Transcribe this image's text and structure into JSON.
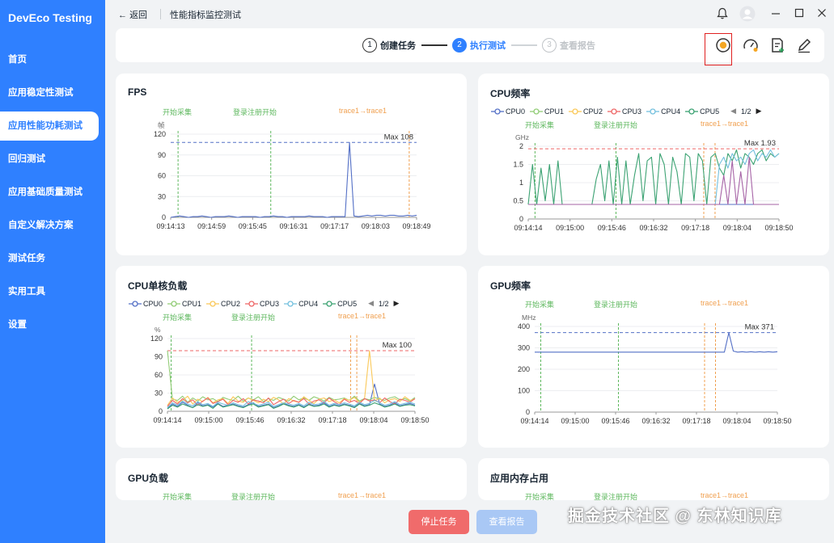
{
  "app": {
    "name": "DevEco Testing"
  },
  "sidebar": {
    "items": [
      {
        "label": "首页"
      },
      {
        "label": "应用稳定性测试"
      },
      {
        "label": "应用性能功耗测试",
        "active": true
      },
      {
        "label": "回归测试"
      },
      {
        "label": "应用基础质量测试"
      },
      {
        "label": "自定义解决方案"
      },
      {
        "label": "测试任务"
      },
      {
        "label": "实用工具"
      },
      {
        "label": "设置"
      }
    ]
  },
  "titlebar": {
    "back_label": "返回",
    "title": "性能指标监控测试",
    "icons": [
      "bell-icon",
      "avatar-icon",
      "minimize-icon",
      "maximize-icon",
      "close-icon"
    ]
  },
  "stepper": {
    "steps": [
      {
        "num": "1",
        "label": "创建任务",
        "state": "done"
      },
      {
        "num": "2",
        "label": "执行测试",
        "state": "active"
      },
      {
        "num": "3",
        "label": "查看报告",
        "state": "disabled"
      }
    ],
    "tools": [
      "record-icon",
      "gauge-icon",
      "add-document-icon",
      "edit-icon"
    ]
  },
  "colors": {
    "accent": "#2f80ff",
    "series": [
      "#5470c6",
      "#91cc75",
      "#fac858",
      "#ee6666",
      "#73c0de",
      "#3ba272"
    ],
    "marker_green": "#5fb85f",
    "marker_orange": "#f0a050",
    "stop_button": "#f06b6b",
    "report_button": "#a9c8f5"
  },
  "markers": {
    "start": "开始采集",
    "login": "登录注册开始",
    "trace": "trace1→trace1"
  },
  "legend": {
    "items": [
      "CPU0",
      "CPU1",
      "CPU2",
      "CPU3",
      "CPU4",
      "CPU5"
    ],
    "page": "1/2"
  },
  "charts": {
    "fps": {
      "title": "FPS",
      "unit": "帧",
      "max_label": "Max 108"
    },
    "cpu_freq": {
      "title": "CPU频率",
      "unit": "GHz",
      "max_label": "Max 1.93"
    },
    "cpu_load": {
      "title": "CPU单核负载",
      "unit": "%",
      "max_label": "Max 100"
    },
    "gpu_freq": {
      "title": "GPU频率",
      "unit": "MHz",
      "max_label": "Max 371"
    },
    "gpu_load": {
      "title": "GPU负载"
    },
    "mem": {
      "title": "应用内存占用"
    }
  },
  "chart_data": [
    {
      "type": "line",
      "title": "FPS",
      "ylabel": "帧",
      "ylim": [
        0,
        120
      ],
      "yticks": [
        0,
        30,
        60,
        90,
        120
      ],
      "xticks": [
        "09:14:13",
        "09:14:59",
        "09:15:45",
        "09:16:31",
        "09:17:17",
        "09:18:03",
        "09:18:49"
      ],
      "annotation": "Max 108",
      "series": [
        {
          "values": [
            0,
            1,
            2,
            1,
            0,
            1,
            1,
            2,
            1,
            0,
            1,
            1,
            1,
            2,
            1,
            0,
            1,
            1,
            1,
            1,
            0,
            1,
            1,
            2,
            1,
            1,
            0,
            1,
            1,
            1,
            1,
            2,
            1,
            1,
            1,
            0,
            1,
            1,
            1,
            1,
            108,
            2,
            1,
            2,
            3,
            2,
            3,
            3,
            2,
            3,
            3,
            2,
            2,
            3,
            2,
            3
          ]
        }
      ]
    },
    {
      "type": "line",
      "title": "CPU频率",
      "ylabel": "GHz",
      "ylim": [
        0,
        2
      ],
      "yticks": [
        0,
        0.5,
        1,
        1.5,
        2
      ],
      "xticks": [
        "09:14:14",
        "09:15:00",
        "09:15:46",
        "09:16:32",
        "09:17:18",
        "09:18:04",
        "09:18:50"
      ],
      "annotation": "Max 1.93",
      "series": [
        {
          "name": "CPU0",
          "values": [
            0.4,
            0.4,
            0.4,
            0.4,
            0.4,
            0.4,
            0.4,
            0.4,
            0.4,
            0.4,
            0.4,
            0.4,
            0.4,
            0.4,
            0.4,
            0.4,
            0.4,
            0.4,
            0.4,
            0.4,
            0.4,
            0.4,
            0.4,
            0.4,
            0.4,
            0.4,
            0.4,
            0.4,
            0.4,
            0.4,
            0.4,
            0.4,
            0.4,
            0.4,
            0.4,
            0.4,
            0.4,
            0.4,
            0.4,
            0.4,
            0.4,
            0.4,
            0.4,
            0.4,
            0.4,
            0.4,
            0.4,
            0.4,
            0.4,
            0.4,
            0.4,
            0.4,
            0.4,
            0.4,
            0.4,
            0.4,
            0.4,
            0.4,
            0.4,
            0.4
          ]
        },
        {
          "name": "CPU3",
          "values": [
            0.4,
            1.5,
            0.4,
            1.4,
            0.5,
            1.5,
            0.4,
            1.6,
            0.4,
            0.4,
            0.4,
            0.4,
            0.4,
            0.4,
            0.4,
            0.4,
            1.1,
            1.5,
            0.5,
            1.6,
            0.4,
            1.7,
            0.4,
            1.6,
            0.4,
            1.2,
            1.8,
            0.5,
            1.6,
            1.7,
            0.4,
            1.8,
            1.5,
            0.4,
            1.7,
            1.3,
            0.4,
            1.8,
            1.7,
            0.5,
            1.8,
            1.6,
            0.4,
            1.7,
            1.8,
            1.4,
            1.2,
            1.8,
            1.6,
            1.9,
            1.4,
            1.8,
            1.7,
            1.5,
            1.8,
            1.9,
            1.6,
            1.8,
            1.7,
            1.8
          ]
        },
        {
          "name": "CPU5",
          "values": [
            0.4,
            0.4,
            0.4,
            0.4,
            0.4,
            0.4,
            0.4,
            0.4,
            0.4,
            0.4,
            0.4,
            0.4,
            0.4,
            0.4,
            0.4,
            0.4,
            0.4,
            0.4,
            0.4,
            0.4,
            0.4,
            0.4,
            0.4,
            0.4,
            0.4,
            0.4,
            0.4,
            0.4,
            0.4,
            0.4,
            0.4,
            0.4,
            0.4,
            0.4,
            0.4,
            0.4,
            0.4,
            0.4,
            0.4,
            0.4,
            0.4,
            0.4,
            0.4,
            0.4,
            0.4,
            1.5,
            1.7,
            1.4,
            1.8,
            1.6,
            1.7,
            1.5,
            1.8,
            1.9,
            1.6,
            1.8,
            1.7,
            1.9,
            1.7,
            1.8
          ]
        },
        {
          "name": "CPU2",
          "values": [
            0.4,
            0.4,
            0.4,
            0.4,
            0.4,
            0.4,
            0.4,
            0.4,
            0.4,
            0.4,
            0.4,
            0.4,
            0.4,
            0.4,
            0.4,
            0.4,
            0.4,
            0.4,
            0.4,
            0.4,
            0.4,
            0.4,
            0.4,
            0.4,
            0.4,
            0.4,
            0.4,
            0.4,
            0.4,
            0.4,
            0.4,
            0.4,
            0.4,
            0.4,
            0.4,
            0.4,
            0.4,
            0.4,
            0.4,
            0.4,
            0.4,
            0.4,
            0.4,
            0.4,
            0.4,
            0.4,
            1.2,
            0.4,
            1.6,
            0.4,
            1.3,
            0.4,
            1.7,
            0.4,
            0.4,
            0.4,
            0.4,
            0.4,
            0.4,
            0.4
          ]
        }
      ]
    },
    {
      "type": "line",
      "title": "CPU单核负载",
      "ylabel": "%",
      "ylim": [
        0,
        120
      ],
      "yticks": [
        0,
        30,
        60,
        90,
        120
      ],
      "xticks": [
        "09:14:14",
        "09:15:00",
        "09:15:46",
        "09:16:32",
        "09:17:18",
        "09:18:04",
        "09:18:50"
      ],
      "annotation": "Max 100",
      "series": [
        {
          "name": "CPU0",
          "values": [
            5,
            12,
            8,
            15,
            10,
            6,
            14,
            9,
            11,
            7,
            13,
            8,
            10,
            12,
            9,
            7,
            11,
            14,
            8,
            10,
            12,
            6,
            9,
            13,
            10,
            8,
            11,
            7,
            12,
            9,
            10,
            14,
            8,
            11,
            9,
            12,
            10,
            7,
            13,
            9,
            11,
            45,
            12,
            8,
            10,
            14,
            9,
            11,
            13,
            10
          ]
        },
        {
          "name": "CPU1",
          "values": [
            100,
            20,
            18,
            25,
            15,
            22,
            17,
            24,
            19,
            21,
            16,
            23,
            20,
            18,
            25,
            17,
            22,
            19,
            24,
            16,
            21,
            18,
            23,
            20,
            17,
            25,
            19,
            22,
            18,
            24,
            21,
            17,
            23,
            19,
            20,
            22,
            18,
            25,
            17,
            21,
            19,
            23,
            20,
            18,
            22,
            24,
            19,
            21,
            17,
            23
          ]
        },
        {
          "name": "CPU2",
          "values": [
            10,
            22,
            15,
            18,
            25,
            12,
            20,
            16,
            23,
            14,
            19,
            21,
            13,
            24,
            17,
            15,
            22,
            18,
            14,
            20,
            16,
            23,
            19,
            12,
            21,
            17,
            15,
            24,
            18,
            13,
            20,
            22,
            16,
            19,
            14,
            21,
            18,
            23,
            15,
            20,
            100,
            17,
            22,
            14,
            19,
            21,
            16,
            24,
            18,
            20
          ]
        },
        {
          "name": "CPU3",
          "values": [
            8,
            18,
            12,
            21,
            14,
            19,
            10,
            17,
            22,
            13,
            16,
            20,
            11,
            18,
            15,
            21,
            12,
            19,
            17,
            14,
            22,
            11,
            16,
            20,
            13,
            18,
            15,
            21,
            12,
            17,
            19,
            14,
            22,
            16,
            11,
            20,
            15,
            18,
            13,
            21,
            17,
            19,
            14,
            22,
            16,
            12,
            20,
            18,
            15,
            21
          ]
        },
        {
          "name": "CPU4",
          "values": [
            6,
            14,
            10,
            17,
            12,
            9,
            16,
            11,
            13,
            8,
            15,
            12,
            10,
            14,
            11,
            9,
            16,
            13,
            10,
            12,
            15,
            8,
            11,
            14,
            12,
            10,
            13,
            9,
            15,
            11,
            12,
            16,
            10,
            13,
            11,
            14,
            12,
            9,
            15,
            11,
            13,
            18,
            14,
            10,
            12,
            16,
            11,
            13,
            15,
            12
          ]
        },
        {
          "name": "CPU5",
          "values": [
            4,
            10,
            7,
            12,
            9,
            6,
            11,
            8,
            10,
            5,
            12,
            7,
            9,
            11,
            8,
            6,
            10,
            12,
            7,
            9,
            11,
            5,
            8,
            12,
            9,
            7,
            10,
            6,
            11,
            8,
            9,
            12,
            7,
            10,
            8,
            11,
            9,
            6,
            12,
            8,
            10,
            14,
            11,
            7,
            9,
            12,
            8,
            10,
            11,
            9
          ]
        }
      ]
    },
    {
      "type": "line",
      "title": "GPU频率",
      "ylabel": "MHz",
      "ylim": [
        0,
        400
      ],
      "yticks": [
        0,
        100,
        200,
        300,
        400
      ],
      "xticks": [
        "09:14:14",
        "09:15:00",
        "09:15:46",
        "09:16:32",
        "09:17:18",
        "09:18:04",
        "09:18:50"
      ],
      "annotation": "Max 371",
      "series": [
        {
          "values": [
            280,
            280,
            280,
            280,
            280,
            280,
            280,
            280,
            280,
            280,
            280,
            280,
            280,
            280,
            280,
            280,
            280,
            280,
            280,
            280,
            280,
            280,
            280,
            280,
            280,
            280,
            280,
            280,
            280,
            280,
            280,
            280,
            280,
            280,
            280,
            280,
            280,
            280,
            280,
            280,
            280,
            280,
            280,
            280,
            371,
            285,
            280,
            282,
            280,
            282,
            280,
            282,
            280,
            282,
            280,
            282
          ]
        }
      ]
    }
  ],
  "buttons": {
    "stop": "停止任务",
    "report": "查看报告"
  },
  "watermark": "掘金技术社区 @ 东林知识库"
}
